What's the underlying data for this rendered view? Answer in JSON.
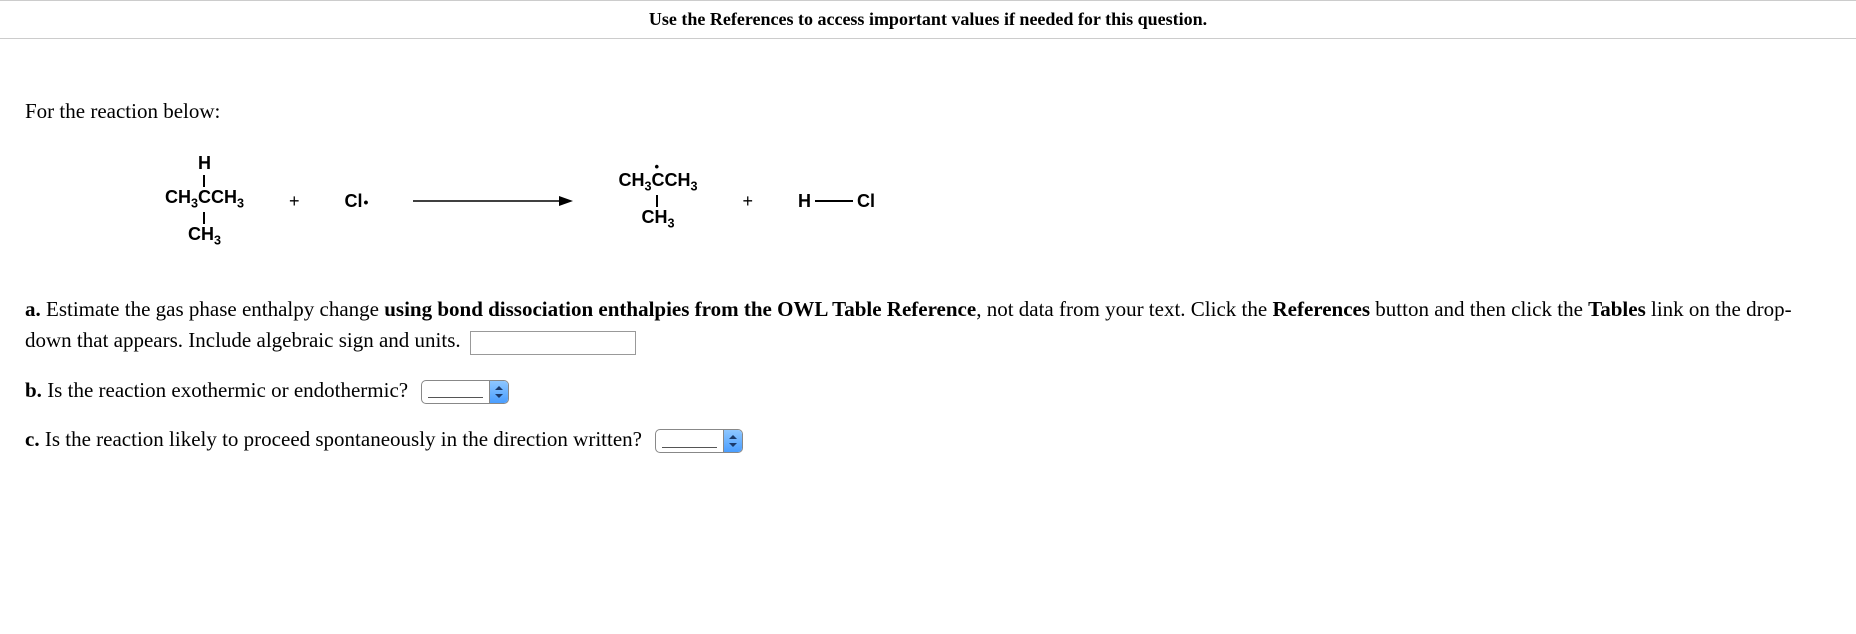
{
  "topbar": "Use the References to access important values if needed for this question.",
  "intro": "For the reaction below:",
  "reaction": {
    "reactant1": {
      "h": "H",
      "main_left": "CH",
      "main_mid": "C",
      "main_left_sub": "3",
      "main_right": "CH",
      "main_right_sub": "3",
      "bottom": "CH",
      "bottom_sub": "3"
    },
    "plus1": "+",
    "reactant2": "Cl",
    "product1": {
      "main_left": "CH",
      "main_left_sub": "3",
      "main_mid": "C",
      "main_right": "CH",
      "main_right_sub": "3",
      "bottom": "CH",
      "bottom_sub": "3"
    },
    "plus2": "+",
    "product2_h": "H",
    "product2_cl": "Cl"
  },
  "parts": {
    "a_letter": "a.",
    "a_pre": " Estimate the gas phase enthalpy change ",
    "a_bold1": "using bond dissociation enthalpies from the OWL Table Reference",
    "a_mid": ", not data from your text. Click the ",
    "a_bold2": "References",
    "a_mid2": " button and then click the ",
    "a_bold3": "Tables",
    "a_post": " link on the drop-down that appears. Include algebraic sign and units.",
    "b_letter": "b.",
    "b_text": " Is the reaction exothermic or endothermic?",
    "c_letter": "c.",
    "c_text": " Is the reaction likely to proceed spontaneously in the direction written?"
  },
  "inputs": {
    "a_value": "",
    "b_value": "",
    "c_value": ""
  }
}
